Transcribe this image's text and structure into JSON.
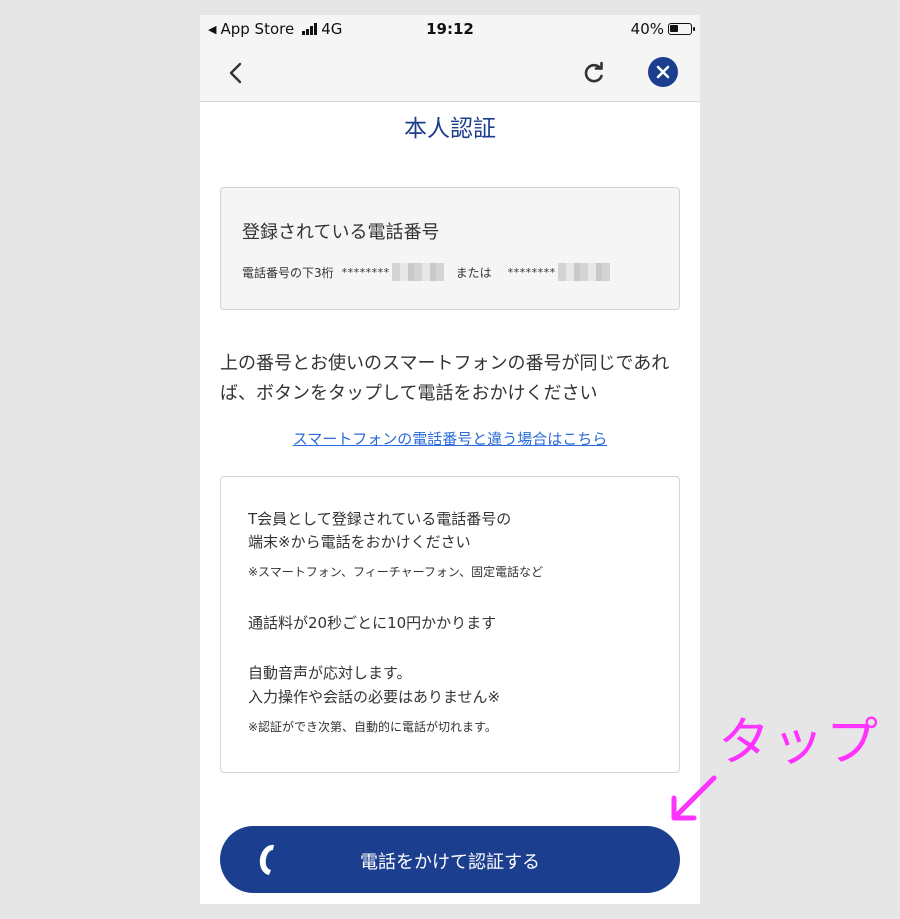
{
  "status_bar": {
    "back_app": "App Store",
    "network": "4G",
    "time": "19:12",
    "battery": "40%"
  },
  "nav": {
    "back_icon": "chevron-left-icon",
    "reload_icon": "reload-icon",
    "close_icon": "close-icon"
  },
  "page": {
    "title": "本人認証"
  },
  "registered_phone": {
    "heading": "登録されている電話番号",
    "last_digits_label": "電話番号の下3桁",
    "masked_1": "********",
    "or_text": "または",
    "masked_2": "********"
  },
  "instruction": {
    "text": "上の番号とお使いのスマートフォンの番号が同じであれば、ボタンをタップして電話をおかけください"
  },
  "different_number_link": "スマートフォンの電話番号と違う場合はこちら",
  "info": {
    "line1": "T会員として登録されている電話番号の",
    "line2": "端末※から電話をおかけください",
    "note1": "※スマートフォン、フィーチャーフォン、固定電話など",
    "charge": "通話料が20秒ごとに10円かかります",
    "auto_voice": "自動音声が応対します。",
    "no_input": "入力操作や会話の必要はありません※",
    "note2": "※認証ができ次第、自動的に電話が切れます。"
  },
  "call_button": {
    "label": "電話をかけて認証する",
    "icon": "phone-icon"
  },
  "annotation": {
    "text": "タップ",
    "color": "#ff33ff"
  },
  "colors": {
    "brand": "#1b3e8f",
    "link": "#2a6ad9"
  }
}
